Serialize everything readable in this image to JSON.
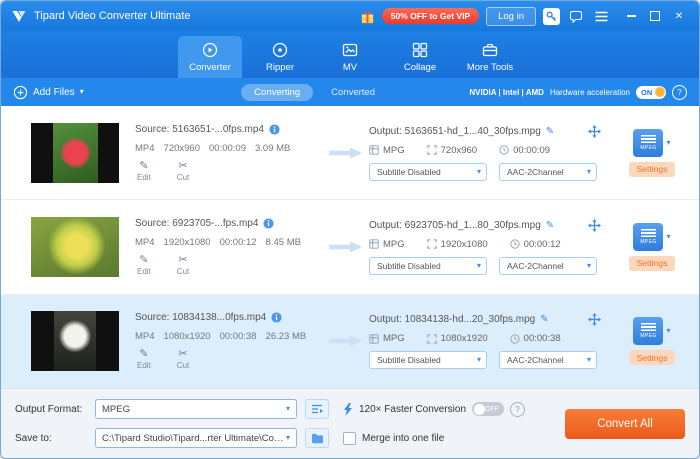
{
  "titlebar": {
    "title": "Tipard Video Converter Ultimate",
    "promo": "50% OFF to Get VIP",
    "login": "Log in"
  },
  "tabs": [
    {
      "label": "Converter",
      "active": true
    },
    {
      "label": "Ripper",
      "active": false
    },
    {
      "label": "MV",
      "active": false
    },
    {
      "label": "Collage",
      "active": false
    },
    {
      "label": "More Tools",
      "active": false
    }
  ],
  "toolbar": {
    "add_files": "Add Files",
    "converting": "Converting",
    "converted": "Converted",
    "hw_brands": "NVIDIA | Intel | AMD",
    "hw_label": "Hardware acceleration",
    "hw_state": "ON"
  },
  "rows": [
    {
      "source_label": "Source: 5163651-...0fps.mp4",
      "format": "MP4",
      "resolution": "720x960",
      "duration": "00:00:09",
      "size": "3.09 MB",
      "edit_label": "Edit",
      "cut_label": "Cut",
      "output_label": "Output: 5163651-hd_1...40_30fps.mpg",
      "out_format": "MPG",
      "out_resolution": "720x960",
      "out_duration": "00:00:09",
      "subtitle": "Subtitle Disabled",
      "audio": "AAC-2Channel",
      "profile": "MPEG",
      "settings_label": "Settings",
      "selected": false
    },
    {
      "source_label": "Source: 6923705-...fps.mp4",
      "format": "MP4",
      "resolution": "1920x1080",
      "duration": "00:00:12",
      "size": "8.45 MB",
      "edit_label": "Edit",
      "cut_label": "Cut",
      "output_label": "Output: 6923705-hd_1...80_30fps.mpg",
      "out_format": "MPG",
      "out_resolution": "1920x1080",
      "out_duration": "00:00:12",
      "subtitle": "Subtitle Disabled",
      "audio": "AAC-2Channel",
      "profile": "MPEG",
      "settings_label": "Settings",
      "selected": false
    },
    {
      "source_label": "Source: 10834138...0fps.mp4",
      "format": "MP4",
      "resolution": "1080x1920",
      "duration": "00:00:38",
      "size": "26.23 MB",
      "edit_label": "Edit",
      "cut_label": "Cut",
      "output_label": "Output: 10834138-hd...20_30fps.mpg",
      "out_format": "MPG",
      "out_resolution": "1080x1920",
      "out_duration": "00:00:38",
      "subtitle": "Subtitle Disabled",
      "audio": "AAC-2Channel",
      "profile": "MPEG",
      "settings_label": "Settings",
      "selected": true
    }
  ],
  "footer": {
    "output_format_label": "Output Format:",
    "output_format_value": "MPEG",
    "faster_label": "120× Faster Conversion",
    "faster_state": "OFF",
    "save_to_label": "Save to:",
    "save_to_value": "C:\\Tipard Studio\\Tipard...rter Ultimate\\Converted",
    "merge_label": "Merge into one file",
    "convert_all": "Convert All"
  },
  "colors": {
    "titlebar_blue": "#1d80e4",
    "active_tab_blue": "#3f97ee",
    "promo_red": "#e93a2c",
    "convert_orange": "#ee5a1c",
    "settings_peach": "#fbd8bd",
    "selected_row": "#dcedfc"
  },
  "icons": {
    "dropdown": "▾",
    "close": "✕",
    "help": "?",
    "pencil": "✎",
    "edit": "✎",
    "scissors": "✂"
  }
}
